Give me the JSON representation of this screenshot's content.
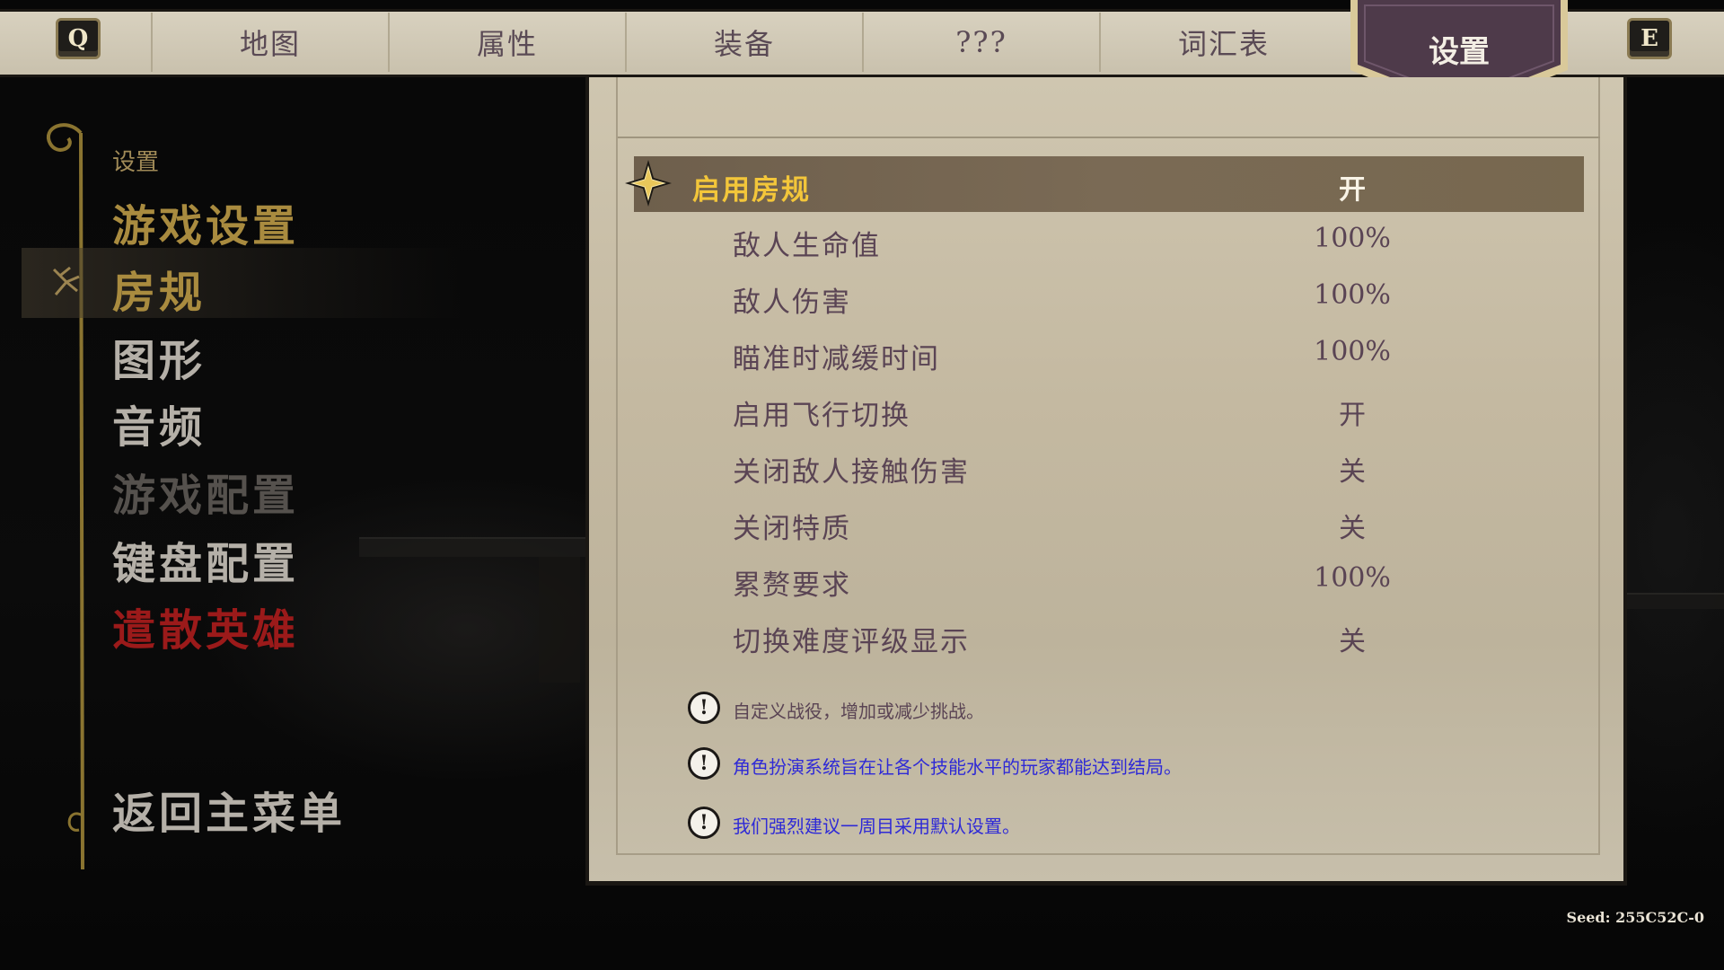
{
  "top_bar": {
    "key_left": "Q",
    "key_right": "E",
    "tabs": [
      {
        "label": "地图"
      },
      {
        "label": "属性"
      },
      {
        "label": "装备"
      },
      {
        "label": "???"
      },
      {
        "label": "词汇表"
      }
    ],
    "active_tab": "设置"
  },
  "left_menu": {
    "header": "设置",
    "items": [
      {
        "label": "游戏设置"
      },
      {
        "label": "房规"
      },
      {
        "label": "图形"
      },
      {
        "label": "音频"
      },
      {
        "label": "游戏配置"
      },
      {
        "label": "键盘配置"
      },
      {
        "label": "遣散英雄"
      }
    ],
    "back": "返回主菜单"
  },
  "settings": {
    "rows": [
      {
        "label": "启用房规",
        "value": "开"
      },
      {
        "label": "敌人生命值",
        "value": "100%"
      },
      {
        "label": "敌人伤害",
        "value": "100%"
      },
      {
        "label": "瞄准时减缓时间",
        "value": "100%"
      },
      {
        "label": "启用飞行切换",
        "value": "开"
      },
      {
        "label": "关闭敌人接触伤害",
        "value": "关"
      },
      {
        "label": "关闭特质",
        "value": "关"
      },
      {
        "label": "累赘要求",
        "value": "100%"
      },
      {
        "label": "切换难度评级显示",
        "value": "关"
      }
    ],
    "notes": [
      {
        "icon": "!",
        "text": "自定义战役，增加或减少挑战。"
      },
      {
        "icon": "!",
        "text": "角色扮演系统旨在让各个技能水平的玩家都能达到结局。"
      },
      {
        "icon": "!",
        "text": "我们强烈建议一周目采用默认设置。"
      }
    ]
  },
  "seed": "Seed: 255C52C-0",
  "colors": {
    "accent_gold": "#f3c63a",
    "menu_gold": "#a98b3f",
    "danger_red": "#9b1a1a",
    "note_blue": "#2f2ad6",
    "parchment": "#c4b9a1",
    "tab_active_bg": "#4e3a4a"
  }
}
